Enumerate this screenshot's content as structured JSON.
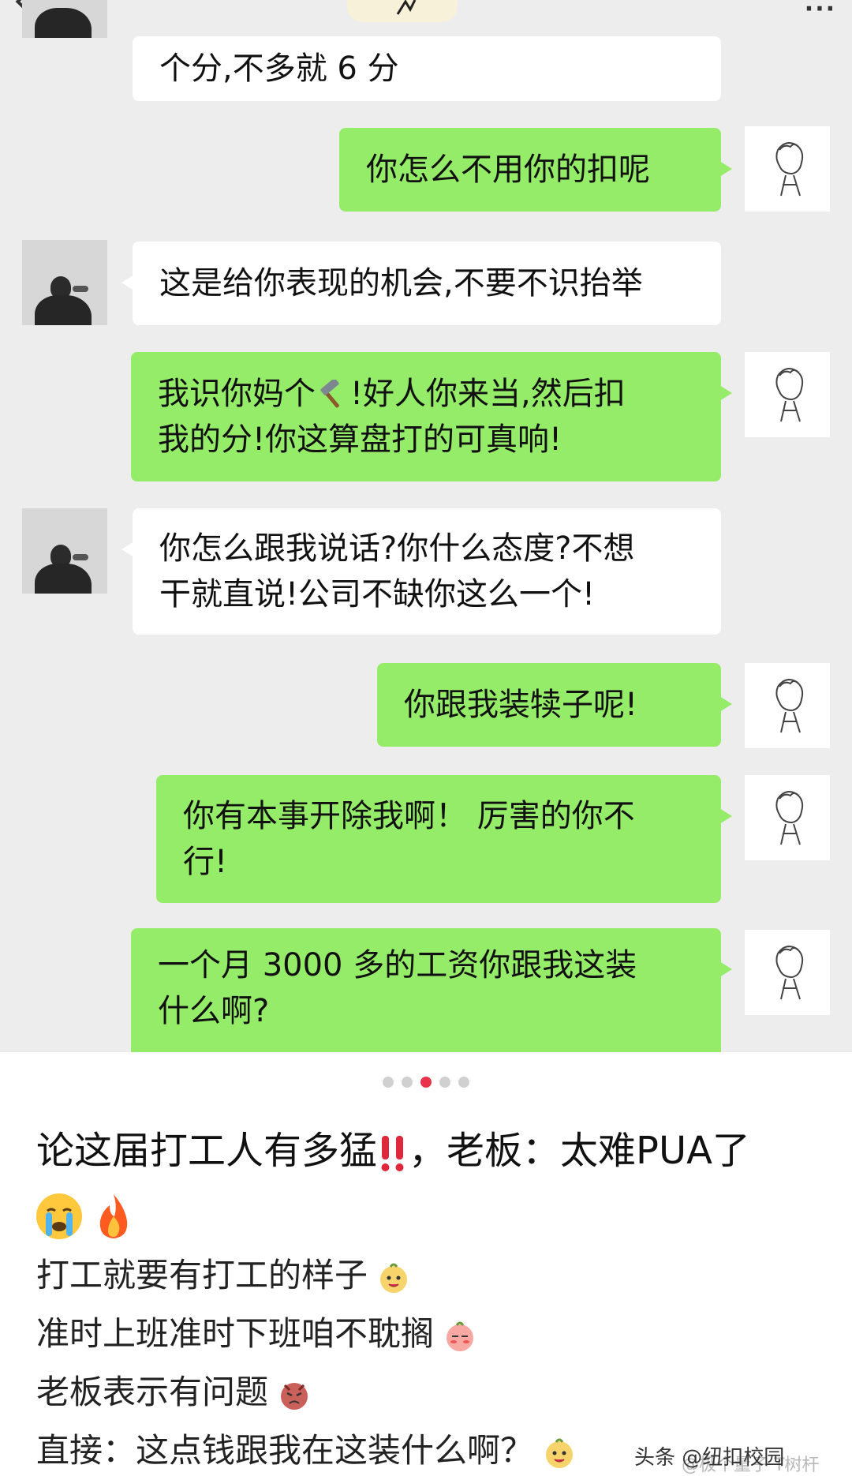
{
  "chat": {
    "messages": [
      {
        "side": "other",
        "text": "个分,不多就 6 分"
      },
      {
        "side": "me",
        "text": "你怎么不用你的扣呢"
      },
      {
        "side": "other",
        "text": "这是给你表现的机会,不要不识抬举"
      },
      {
        "side": "me",
        "text_before": "我识你妈个",
        "icon": "hammer-emoji",
        "text_after": "!好人你来当,然后扣\n我的分!你这算盘打的可真响!"
      },
      {
        "side": "other",
        "text": "你怎么跟我说话?你什么态度?不想\n干就直说!公司不缺你这么一个!"
      },
      {
        "side": "me",
        "text": "你跟我装犊子呢!"
      },
      {
        "side": "me",
        "text": "你有本事开除我啊！ 厉害的你不\n行!"
      },
      {
        "side": "me",
        "text": "一个月 3000 多的工资你跟我这装\n什么啊?"
      }
    ]
  },
  "carousel": {
    "total": 5,
    "active_index": 2,
    "active_color": "#e8334a"
  },
  "post": {
    "title_part1": "论这届打工人有多猛",
    "title_part2": "，老板：太难PUA了",
    "title_emojis": [
      "double-exclamation-emoji",
      "crying-face-emoji",
      "fire-emoji"
    ],
    "lines": [
      "打工就要有打工的样子",
      "准时上班准时下班咱不耽搁",
      "老板表示有问题",
      "直接：这点钱跟我在这装什么啊？"
    ],
    "line_emojis": [
      "happy-sticker-emoji",
      "shy-sticker-emoji",
      "angry-sticker-emoji",
      "happy-sticker-emoji"
    ]
  },
  "watermark": {
    "text": "头条 @纽扣校园",
    "faint_text": "@极个量子 T树杆"
  },
  "colors": {
    "chat_bg": "#ededed",
    "green_bubble": "#95ec69",
    "white_bubble": "#ffffff"
  }
}
